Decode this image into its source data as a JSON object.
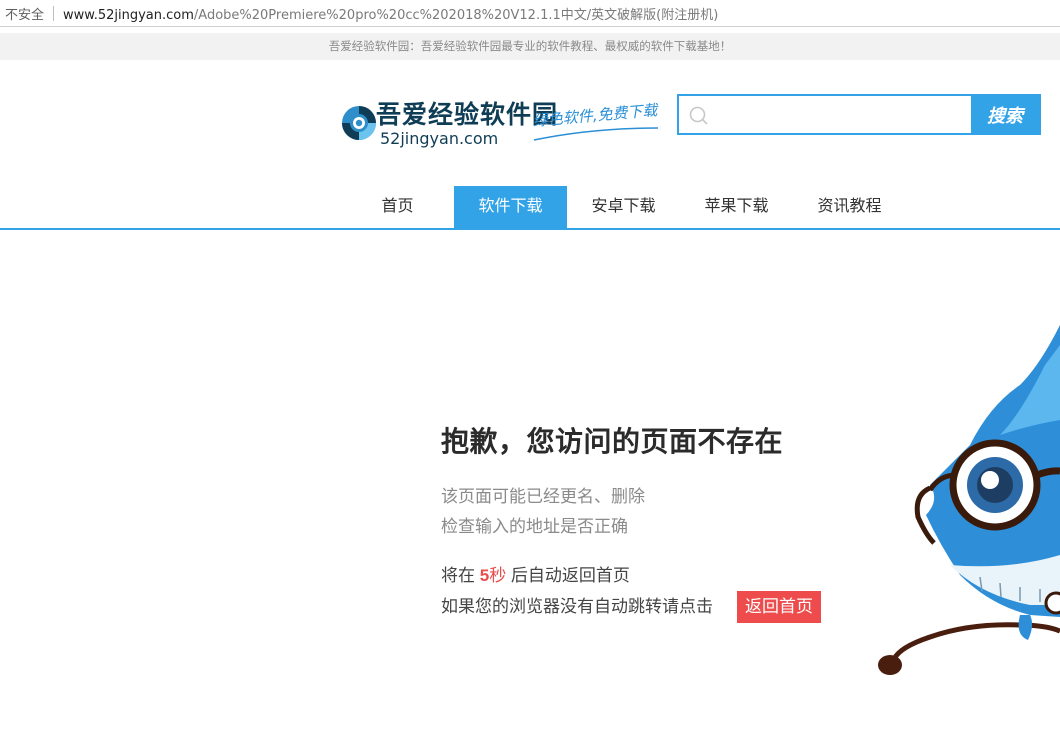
{
  "browser": {
    "security_label": "不安全",
    "url_host": "www.52jingyan.com",
    "url_path": "/Adobe%20Premiere%20pro%20cc%202018%20V12.1.1中文/英文破解版(附注册机)"
  },
  "notice": {
    "text": "吾爱经验软件园：吾爱经验软件园最专业的软件教程、最权威的软件下载基地！"
  },
  "header": {
    "logo_text": "吾爱经验软件园",
    "logo_domain": "52jingyan.com",
    "slogan": "绿色软件,免费下载",
    "search_placeholder": "",
    "search_button": "搜索"
  },
  "nav": {
    "items": [
      {
        "label": "首页"
      },
      {
        "label": "软件下载"
      },
      {
        "label": "安卓下载"
      },
      {
        "label": "苹果下载"
      },
      {
        "label": "资讯教程"
      }
    ],
    "active_index": 1
  },
  "error": {
    "title": "抱歉，您访问的页面不存在",
    "line1": "该页面可能已经更名、删除",
    "line2": "检查输入的地址是否正确",
    "countdown_prefix": "将在 ",
    "countdown_value": "5",
    "countdown_unit": "秒",
    "countdown_suffix": " 后自动返回首页",
    "redirect_text": "如果您的浏览器没有自动跳转请点击",
    "home_button": "返回首页"
  },
  "colors": {
    "accent": "#33a3e8",
    "danger": "#ee4c4c",
    "logo": "#0f3d56"
  }
}
